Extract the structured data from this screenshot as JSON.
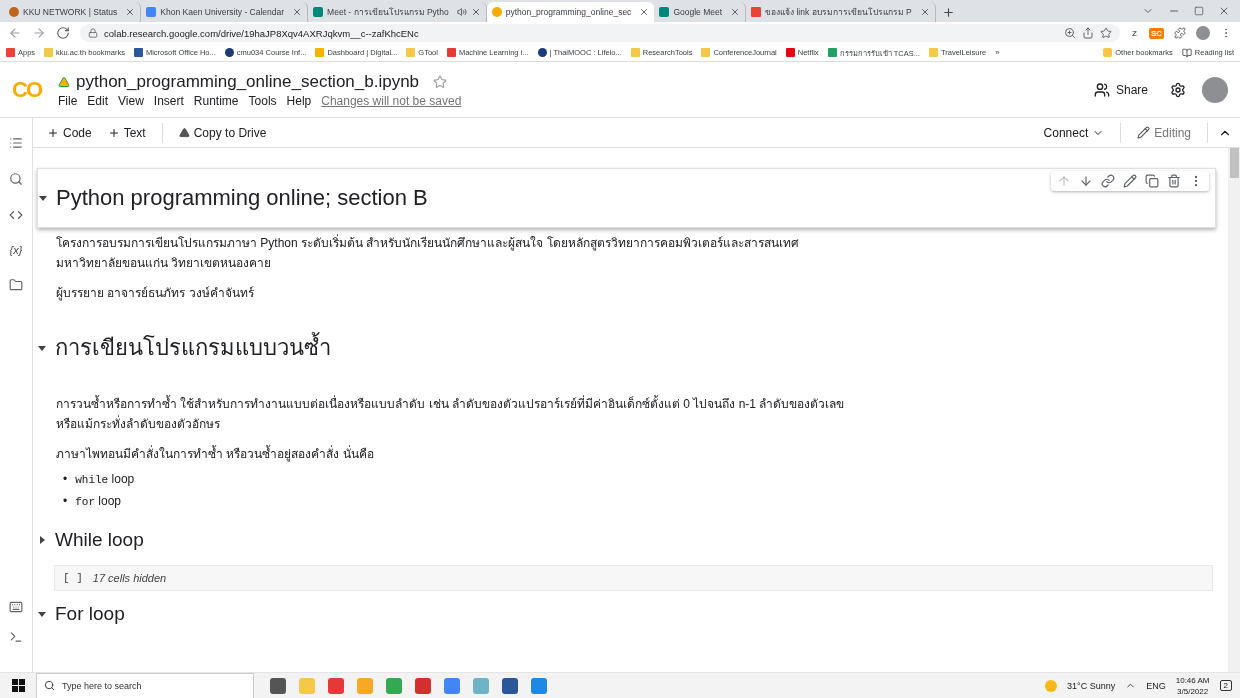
{
  "browser": {
    "tabs": [
      {
        "title": "KKU NETWORK | Status",
        "audible": false,
        "selected": false
      },
      {
        "title": "Khon Kaen University - Calendar",
        "audible": false,
        "selected": false
      },
      {
        "title": "Meet - การเขียนโปรแกรม Pytho",
        "audible": true,
        "selected": false
      },
      {
        "title": "python_programming_online_sec",
        "audible": false,
        "selected": true
      },
      {
        "title": "Google Meet",
        "audible": false,
        "selected": false
      },
      {
        "title": "ของแจ้ง link อบรมการเขียนโปรแกรม P",
        "audible": false,
        "selected": false
      }
    ],
    "address": "colab.research.google.com/drive/19haJP8Xqv4AXRJqkvm__c--zafKhcENc",
    "extensions": [
      {
        "label": "Z",
        "color": "#5f6368"
      },
      {
        "label": "SC",
        "color": "#f57c00"
      }
    ],
    "bookmarks": [
      "Apps",
      "kku.ac.th bookmarks",
      "Microsoft Office Ho...",
      "cmu034 Course Inf...",
      "Dashboard | Digital...",
      "GTool",
      "Machine Learning i...",
      "| ThaiMOOC : Lifelo...",
      "ResearchTools",
      "ConferenceJournal",
      "Netflix",
      "กรรมการรับเข้า TCAS...",
      "TravelLeisure"
    ],
    "more": "»",
    "other_bookmarks": "Other bookmarks",
    "reading_list": "Reading list"
  },
  "colab": {
    "logo": "CO",
    "filename": "python_programming_online_section_b.ipynb",
    "starred": false,
    "menu": [
      "File",
      "Edit",
      "View",
      "Insert",
      "Runtime",
      "Tools",
      "Help"
    ],
    "notice": "Changes will not be saved",
    "share": "Share",
    "toolbar": {
      "add_code": "Code",
      "add_text": "Text",
      "copy": "Copy to Drive",
      "connect": "Connect",
      "mode": "Editing"
    }
  },
  "sidebar": {
    "variables": "{x}"
  },
  "cells": [
    {
      "kind": "heading",
      "text": "Python programming online; section B",
      "expanded": true,
      "selected": true
    },
    {
      "kind": "text",
      "text": "โครงการอบรมการเขียนโปรแกรมภาษา Python ระดับเริ่มต้น สำหรับนักเรียนนักศึกษาและผู้สนใจ โดยหลักสูตรวิทยาการคอมพิวเตอร์และสารสนเทศ\nมหาวิทยาลัยขอนแก่น วิทยาเขตหนองคาย"
    },
    {
      "kind": "text",
      "text": "ผู้บรรยาย อาจารย์ธนภัทร วงษ์คำจันทร์"
    },
    {
      "kind": "heading",
      "text": "การเขียนโปรแกรมแบบวนซ้ำ",
      "expanded": true,
      "selected": false
    },
    {
      "kind": "text",
      "text": "การวนซ้ำหรือการทำซ้ำ ใช้สำหรับการทำงานแบบต่อเนื่องหรือแบบลำดับ เช่น ลำดับของตัวแปรอาร์เรย์ที่มีค่าอินเด็กซ์ตั้งแต่ 0 ไปจนถึง n-1 ลำดับของตัวเลข\nหรือแม้กระทั่งลำดับของตัวอักษร"
    },
    {
      "kind": "text",
      "text": "ภาษาไพทอนมีคำสั่งในการทำซ้ำ หรือวนซ้ำอยู่สองคำสั่ง นั่นคือ"
    },
    {
      "kind": "list",
      "items": [
        {
          "marker": "•",
          "code": "while",
          "text": "loop"
        },
        {
          "marker": "•",
          "code": "for",
          "text": "loop"
        }
      ]
    },
    {
      "kind": "subheading",
      "text": "While loop",
      "expanded": false,
      "selected": false
    },
    {
      "kind": "hidden",
      "bracket": "[ ]",
      "text": "17 cells hidden"
    },
    {
      "kind": "subheading",
      "text": "For loop",
      "expanded": true,
      "selected": false
    }
  ],
  "taskbar": {
    "search": {
      "placeholder": "Type here to search"
    },
    "weather": "31°C Sunny",
    "language": "ENG",
    "time": "10:46 AM",
    "date": "3/5/2022",
    "notifications": "2"
  }
}
